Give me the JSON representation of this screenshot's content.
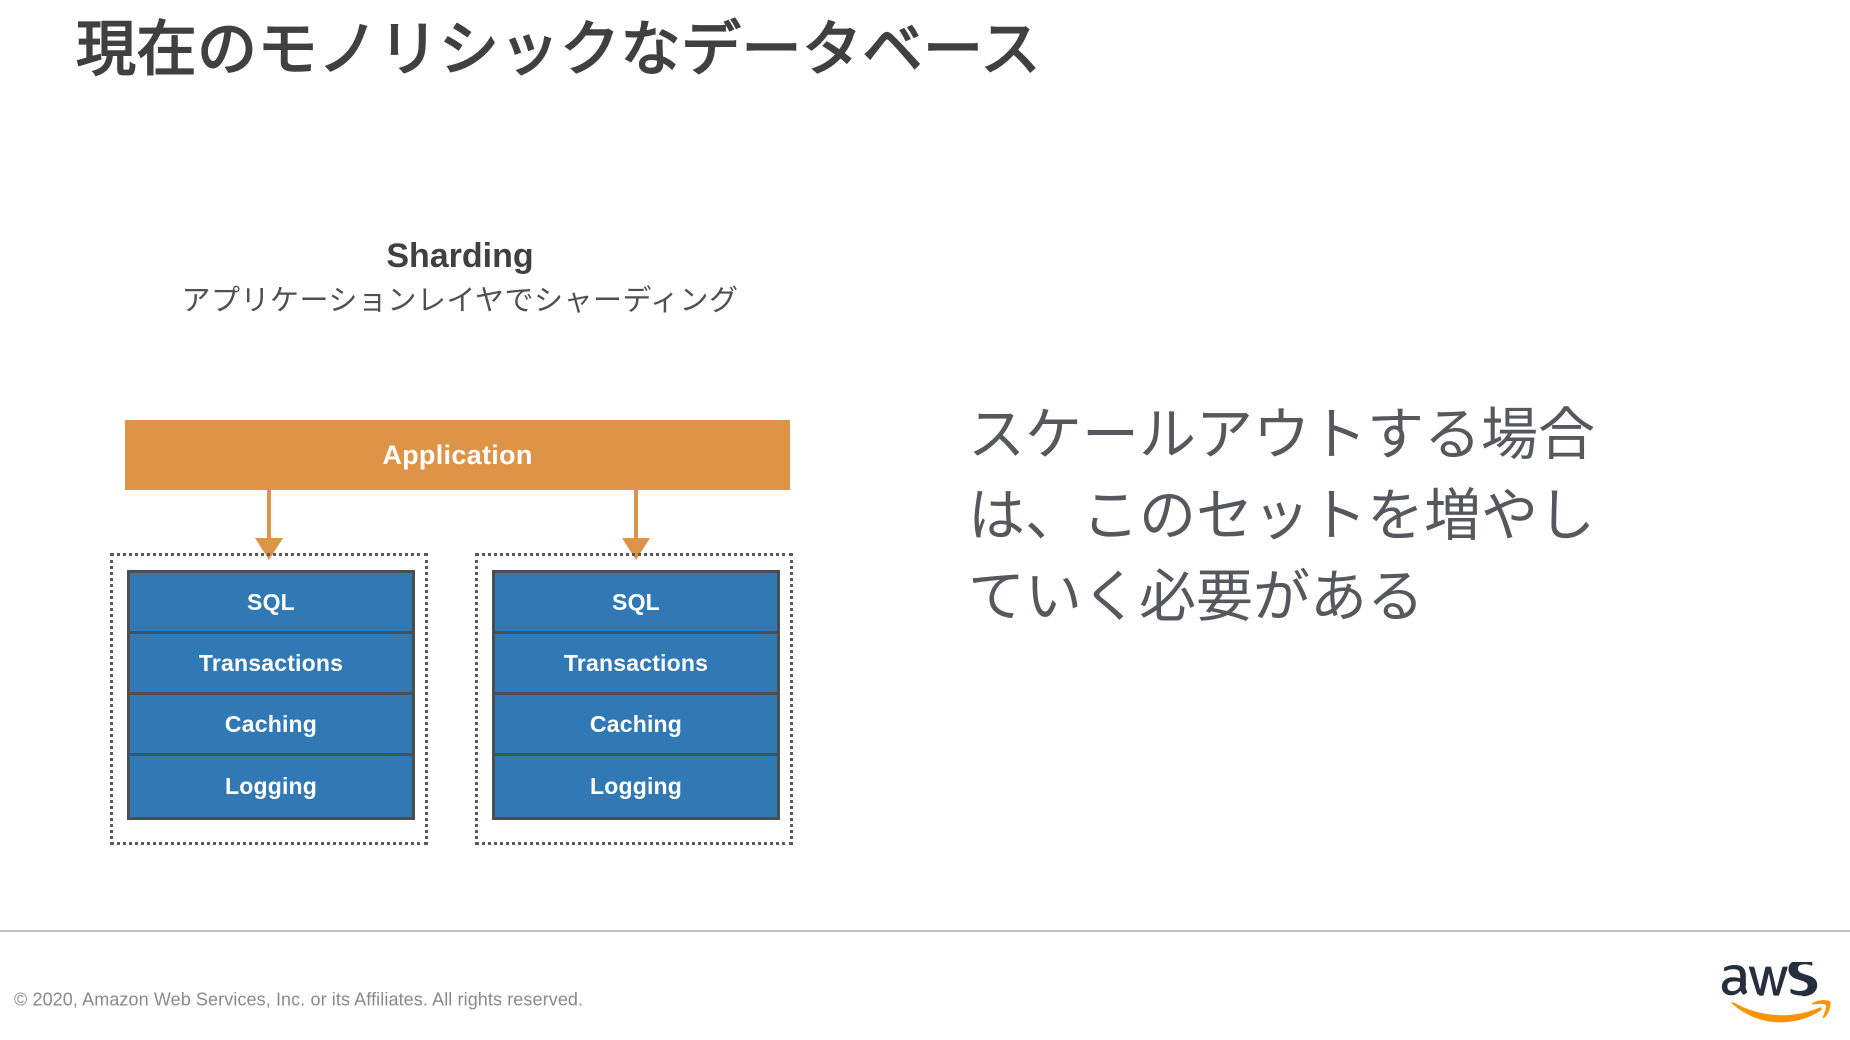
{
  "slide": {
    "title": "現在のモノリシックなデータベース",
    "background_color": "#ffffff",
    "title_color": "#404040"
  },
  "diagram": {
    "heading": "Sharding",
    "subheading": "アプリケーションレイヤでシャーディング",
    "application": {
      "label": "Application",
      "fill_color": "#de9446",
      "text_color": "#ffffff"
    },
    "connector": {
      "color": "#de9446",
      "count": 2,
      "direction": "down"
    },
    "shards": [
      {
        "name": "shard-left",
        "border_style": "dotted",
        "border_color": "#555a5e",
        "layers": [
          "SQL",
          "Transactions",
          "Caching",
          "Logging"
        ],
        "layer_fill_color": "#3179b5",
        "layer_border_color": "#4a4f54",
        "layer_text_color": "#ffffff"
      },
      {
        "name": "shard-right",
        "border_style": "dotted",
        "border_color": "#555a5e",
        "layers": [
          "SQL",
          "Transactions",
          "Caching",
          "Logging"
        ],
        "layer_fill_color": "#3179b5",
        "layer_border_color": "#4a4f54",
        "layer_text_color": "#ffffff"
      }
    ]
  },
  "note": {
    "text": "スケールアウトする場合は、このセットを増やしていく必要がある",
    "color": "#55595d"
  },
  "footer": {
    "copyright": "© 2020, Amazon Web Services, Inc. or its Affiliates. All rights reserved.",
    "logo_wordmark": "aws",
    "logo_text_color": "#252f3e",
    "logo_smile_color": "#f79400",
    "divider_color": "#c0c0c0"
  }
}
